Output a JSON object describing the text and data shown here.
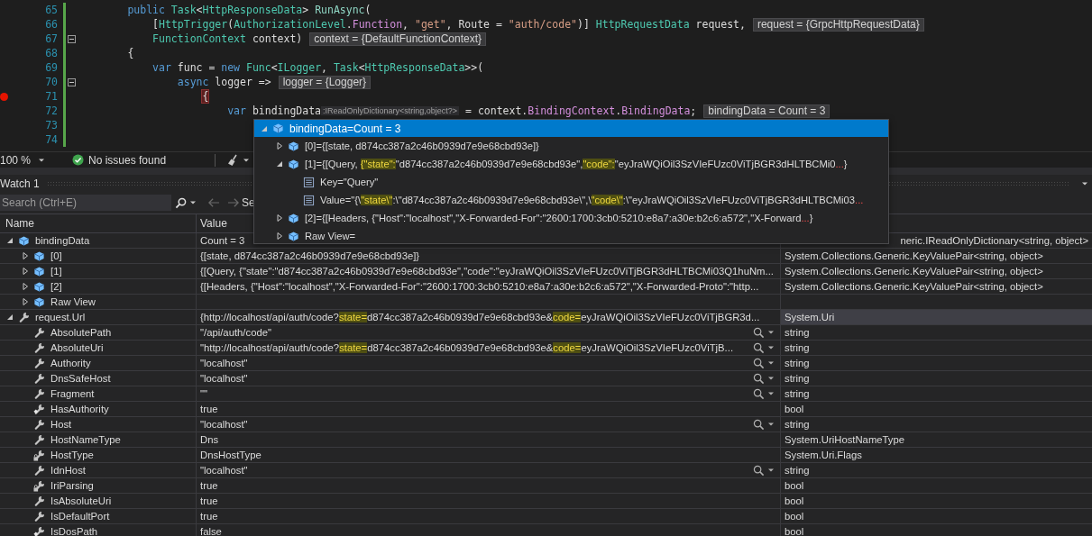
{
  "editor": {
    "lines": [
      {
        "number": "65",
        "changed": true,
        "fold": false,
        "breakpoint": false,
        "parts": [
          {
            "kind": "code",
            "tokens": [
              {
                "kind": "kw",
                "text": "        public "
              },
              {
                "kind": "type",
                "text": "Task"
              },
              {
                "kind": "plain",
                "text": "<"
              },
              {
                "kind": "type",
                "text": "HttpResponseData"
              },
              {
                "kind": "plain",
                "text": "> "
              },
              {
                "kind": "method",
                "text": "RunAsync"
              },
              {
                "kind": "plain",
                "text": "("
              }
            ]
          }
        ]
      },
      {
        "number": "66",
        "changed": true,
        "fold": false,
        "breakpoint": false,
        "parts": [
          {
            "kind": "code",
            "tokens": [
              {
                "kind": "plain",
                "text": "            ["
              },
              {
                "kind": "type",
                "text": "HttpTrigger"
              },
              {
                "kind": "plain",
                "text": "("
              },
              {
                "kind": "type",
                "text": "AuthorizationLevel"
              },
              {
                "kind": "plain",
                "text": "."
              },
              {
                "kind": "member",
                "text": "Function"
              },
              {
                "kind": "plain",
                "text": ", "
              },
              {
                "kind": "string",
                "text": "\"get\""
              },
              {
                "kind": "plain",
                "text": ", Route = "
              },
              {
                "kind": "string",
                "text": "\"auth/code\""
              },
              {
                "kind": "plain",
                "text": ")] "
              },
              {
                "kind": "type",
                "text": "HttpRequestData"
              },
              {
                "kind": "plain",
                "text": " request,"
              }
            ]
          },
          {
            "kind": "datatip",
            "text": "request = {GrpcHttpRequestData}"
          }
        ]
      },
      {
        "number": "67",
        "changed": true,
        "fold": true,
        "breakpoint": false,
        "parts": [
          {
            "kind": "code",
            "tokens": [
              {
                "kind": "type",
                "text": "            FunctionContext"
              },
              {
                "kind": "plain",
                "text": " context)"
              }
            ]
          },
          {
            "kind": "datatip",
            "text": "context = {DefaultFunctionContext}"
          }
        ]
      },
      {
        "number": "68",
        "changed": true,
        "fold": false,
        "breakpoint": false,
        "parts": [
          {
            "kind": "code",
            "tokens": [
              {
                "kind": "plain",
                "text": "        {"
              }
            ]
          }
        ]
      },
      {
        "number": "69",
        "changed": true,
        "fold": false,
        "breakpoint": false,
        "parts": [
          {
            "kind": "code",
            "tokens": [
              {
                "kind": "kw",
                "text": "            var"
              },
              {
                "kind": "plain",
                "text": " func = "
              },
              {
                "kind": "kw",
                "text": "new "
              },
              {
                "kind": "type",
                "text": "Func"
              },
              {
                "kind": "plain",
                "text": "<"
              },
              {
                "kind": "type",
                "text": "ILogger"
              },
              {
                "kind": "plain",
                "text": ", "
              },
              {
                "kind": "type",
                "text": "Task"
              },
              {
                "kind": "plain",
                "text": "<"
              },
              {
                "kind": "type",
                "text": "HttpResponseData"
              },
              {
                "kind": "plain",
                "text": ">>("
              }
            ]
          }
        ]
      },
      {
        "number": "70",
        "changed": true,
        "fold": true,
        "breakpoint": false,
        "parts": [
          {
            "kind": "code",
            "tokens": [
              {
                "kind": "kw",
                "text": "                async"
              },
              {
                "kind": "plain",
                "text": " logger =>"
              }
            ]
          },
          {
            "kind": "datatip",
            "text": "logger = {Logger}"
          }
        ]
      },
      {
        "number": "71",
        "changed": true,
        "fold": false,
        "breakpoint": true,
        "parts": [
          {
            "kind": "code",
            "tokens": [
              {
                "kind": "brace",
                "text": "                    {"
              }
            ]
          }
        ]
      },
      {
        "number": "72",
        "changed": true,
        "fold": false,
        "breakpoint": false,
        "parts": [
          {
            "kind": "code",
            "tokens": [
              {
                "kind": "kw",
                "text": "                        var"
              },
              {
                "kind": "plain",
                "text": " bindingData"
              }
            ]
          },
          {
            "kind": "hint",
            "text": ":IReadOnlyDictionary<string,object?>"
          },
          {
            "kind": "code",
            "tokens": [
              {
                "kind": "plain",
                "text": " = context."
              },
              {
                "kind": "member",
                "text": "BindingContext"
              },
              {
                "kind": "plain",
                "text": "."
              },
              {
                "kind": "member",
                "text": "BindingData"
              },
              {
                "kind": "plain",
                "text": ";"
              }
            ]
          },
          {
            "kind": "datatip",
            "text": "bindingData = Count = 3"
          }
        ]
      },
      {
        "number": "73",
        "changed": true,
        "fold": false,
        "breakpoint": false
      },
      {
        "number": "74",
        "changed": true,
        "fold": false,
        "breakpoint": false
      }
    ]
  },
  "status": {
    "zoom": "100 %",
    "issues": "No issues found"
  },
  "watch": {
    "title": "Watch 1",
    "search": {
      "placeholder": "Search (Ctrl+E)"
    },
    "search_depth_label": "Se",
    "columns": [
      "Name",
      "Value"
    ],
    "rows": [
      {
        "name": "bindingData",
        "value": "Count = 3",
        "type": "neric.IReadOnlyDictionary<string, object>",
        "kind": "object",
        "expanded": true,
        "visualizer": false,
        "selected": false,
        "children": [
          {
            "name": "[0]",
            "value": "{[state, d874cc387a2c46b0939d7e9e68cbd93e]}",
            "type": "System.Collections.Generic.KeyValuePair<string, object>",
            "kind": "object",
            "expanded": false,
            "visualizer": false,
            "selected": false
          },
          {
            "name": "[1]",
            "value": "{[Query, {\"state\":\"d874cc387a2c46b0939d7e9e68cbd93e\",\"code\":\"eyJraWQiOil3SzVIeFUzc0ViTjBGR3dHLTBCMi03Q1huNm...",
            "type": "System.Collections.Generic.KeyValuePair<string, object>",
            "kind": "object",
            "expanded": false,
            "visualizer": false,
            "selected": false
          },
          {
            "name": "[2]",
            "value": "{[Headers, {\"Host\":\"localhost\",\"X-Forwarded-For\":\"2600:1700:3cb0:5210:e8a7:a30e:b2c6:a572\",\"X-Forwarded-Proto\":\"http...",
            "type": "System.Collections.Generic.KeyValuePair<string, object>",
            "kind": "object",
            "expanded": false,
            "visualizer": false,
            "selected": false
          },
          {
            "name": "Raw View",
            "kind": "object",
            "expanded": false,
            "visualizer": false,
            "selected": false
          }
        ]
      },
      {
        "name": "request.Url",
        "value": [
          {
            "text": "{http://localhost/api/auth/code?",
            "match": false
          },
          {
            "text": "state=",
            "match": true
          },
          {
            "text": "d874cc387a2c46b0939d7e9e68cbd93e&",
            "match": false
          },
          {
            "text": "code=",
            "match": true
          },
          {
            "text": "eyJraWQiOil3SzVIeFUzc0ViTjBGR3d...",
            "match": false
          }
        ],
        "type": "System.Uri",
        "kind": "property",
        "expanded": true,
        "visualizer": false,
        "selected": true,
        "children": [
          {
            "name": "AbsolutePath",
            "value": "\"/api/auth/code\"",
            "type": "string",
            "kind": "property",
            "visualizer": true,
            "selected": false
          },
          {
            "name": "AbsoluteUri",
            "value": [
              {
                "text": "\"http://localhost/api/auth/code?",
                "match": false
              },
              {
                "text": "state=",
                "match": true
              },
              {
                "text": "d874cc387a2c46b0939d7e9e68cbd93e&",
                "match": false
              },
              {
                "text": "code=",
                "match": true
              },
              {
                "text": "eyJraWQiOil3SzVIeFUzc0ViTjB...",
                "match": false
              }
            ],
            "type": "string",
            "kind": "property",
            "visualizer": true,
            "selected": false
          },
          {
            "name": "Authority",
            "value": "\"localhost\"",
            "type": "string",
            "kind": "property",
            "visualizer": true,
            "selected": false
          },
          {
            "name": "DnsSafeHost",
            "value": "\"localhost\"",
            "type": "string",
            "kind": "property",
            "visualizer": true,
            "selected": false
          },
          {
            "name": "Fragment",
            "value": "\"\"",
            "type": "string",
            "kind": "property",
            "visualizer": true,
            "selected": false
          },
          {
            "name": "HasAuthority",
            "value": "true",
            "type": "bool",
            "kind": "property-overlay",
            "visualizer": false,
            "selected": false
          },
          {
            "name": "Host",
            "value": "\"localhost\"",
            "type": "string",
            "kind": "property",
            "visualizer": true,
            "selected": false
          },
          {
            "name": "HostNameType",
            "value": "Dns",
            "type": "System.UriHostNameType",
            "kind": "property",
            "visualizer": false,
            "selected": false
          },
          {
            "name": "HostType",
            "value": "DnsHostType",
            "type": "System.Uri.Flags",
            "kind": "property-lock",
            "visualizer": false,
            "selected": false
          },
          {
            "name": "IdnHost",
            "value": "\"localhost\"",
            "type": "string",
            "kind": "property",
            "visualizer": true,
            "selected": false
          },
          {
            "name": "IriParsing",
            "value": "true",
            "type": "bool",
            "kind": "property-lock",
            "visualizer": false,
            "selected": false
          },
          {
            "name": "IsAbsoluteUri",
            "value": "true",
            "type": "bool",
            "kind": "property",
            "visualizer": false,
            "selected": false
          },
          {
            "name": "IsDefaultPort",
            "value": "true",
            "type": "bool",
            "kind": "property",
            "visualizer": false,
            "selected": false
          },
          {
            "name": "IsDosPath",
            "value": "false",
            "type": "bool",
            "kind": "property-overlay",
            "visualizer": false,
            "selected": false
          }
        ]
      }
    ]
  },
  "datatip": {
    "header": {
      "text": "bindingData=Count = 3",
      "expanded": true,
      "selected": true
    },
    "rows": [
      {
        "kind": "object",
        "expanded": false,
        "selected": false,
        "segments": [
          {
            "kind": "plain",
            "text": "[0]={[state, d874cc387a2c46b0939d7e9e68cbd93e]}"
          }
        ]
      },
      {
        "kind": "object",
        "expanded": true,
        "selected": false,
        "segments": [
          {
            "kind": "plain",
            "text": "[1]={[Query, "
          },
          {
            "kind": "match",
            "text": "{\"state\":"
          },
          {
            "kind": "plain",
            "text": "\"d874cc387a2c46b0939d7e9e68cbd93e\","
          },
          {
            "kind": "match",
            "text": "\"code\":"
          },
          {
            "kind": "plain",
            "text": "\"eyJraWQiOil3SzVIeFUzc0ViTjBGR3dHLTBCMi0"
          },
          {
            "kind": "ellipsis",
            "text": "..."
          },
          {
            "kind": "plain",
            "text": "}"
          }
        ],
        "children": [
          {
            "kind": "field",
            "selected": false,
            "segments": [
              {
                "kind": "plain",
                "text": "Key=\"Query\""
              }
            ]
          },
          {
            "kind": "field",
            "selected": false,
            "segments": [
              {
                "kind": "plain",
                "text": "Value=\"{\\"
              },
              {
                "kind": "match",
                "text": "\"state\\\""
              },
              {
                "kind": "plain",
                "text": ":\\\"d874cc387a2c46b0939d7e9e68cbd93e\\\",\\"
              },
              {
                "kind": "match",
                "text": "\"code\\\""
              },
              {
                "kind": "plain",
                "text": ":\\\"eyJraWQiOil3SzVIeFUzc0ViTjBGR3dHLTBCMi03"
              },
              {
                "kind": "ellipsis",
                "text": "..."
              }
            ]
          }
        ]
      },
      {
        "kind": "object",
        "expanded": false,
        "selected": false,
        "segments": [
          {
            "kind": "plain",
            "text": "[2]={[Headers, {\"Host\":\"localhost\",\"X-Forwarded-For\":\"2600:1700:3cb0:5210:e8a7:a30e:b2c6:a572\",\"X-Forward"
          },
          {
            "kind": "ellipsis",
            "text": "..."
          },
          {
            "kind": "plain",
            "text": "}"
          }
        ]
      },
      {
        "kind": "object",
        "expanded": false,
        "selected": false,
        "segments": [
          {
            "kind": "plain",
            "text": "Raw View="
          }
        ]
      }
    ]
  }
}
